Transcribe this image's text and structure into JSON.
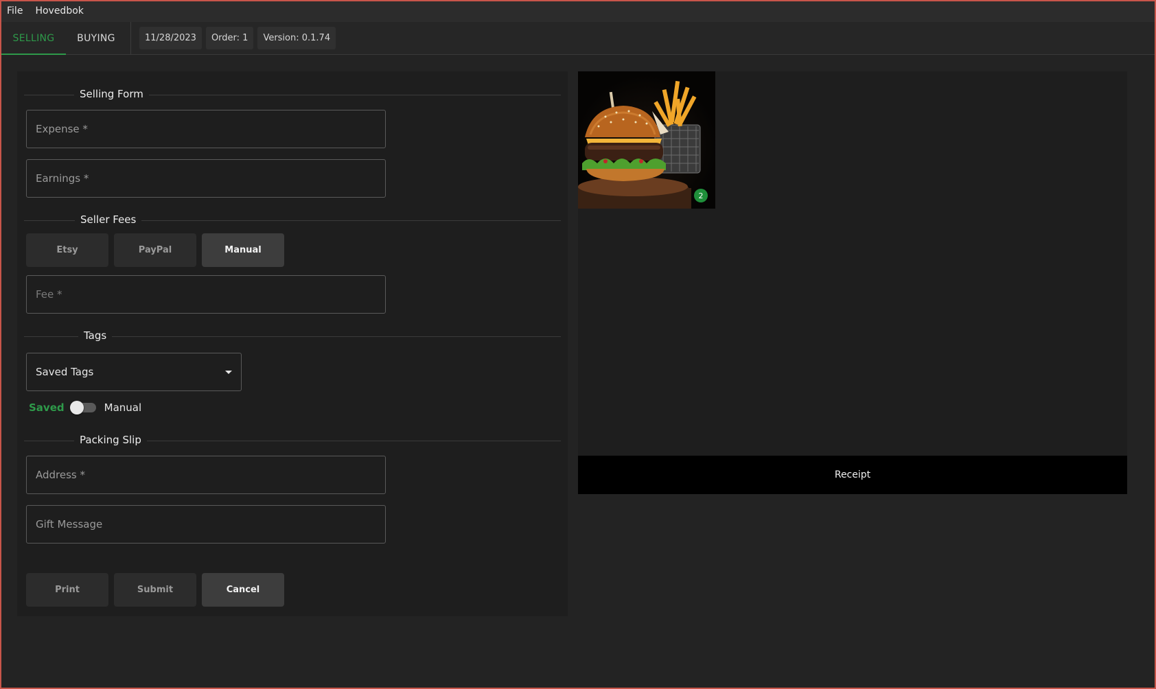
{
  "menubar": {
    "items": [
      "File",
      "Hovedbok"
    ]
  },
  "tabs": [
    {
      "label": "SELLING",
      "active": true
    },
    {
      "label": "BUYING",
      "active": false
    }
  ],
  "status": {
    "date": "11/28/2023",
    "order": "Order: 1",
    "version": "Version: 0.1.74"
  },
  "form": {
    "selling_title": "Selling Form",
    "expense_placeholder": "Expense *",
    "earnings_placeholder": "Earnings *",
    "fees_title": "Seller Fees",
    "fee_options": [
      "Etsy",
      "PayPal",
      "Manual"
    ],
    "fee_selected": "Manual",
    "fee_placeholder": "Fee *",
    "tags_title": "Tags",
    "tags_select_value": "Saved Tags",
    "toggle_left": "Saved",
    "toggle_right": "Manual",
    "packing_title": "Packing Slip",
    "address_placeholder": "Address *",
    "gift_placeholder": "Gift Message",
    "actions": {
      "print": "Print",
      "submit": "Submit",
      "cancel": "Cancel"
    }
  },
  "preview": {
    "image_alt": "burger-and-fries-photo",
    "badge_count": "2",
    "receipt_label": "Receipt"
  },
  "colors": {
    "accent": "#2e9a4a",
    "frame": "#c8554a",
    "badge": "#1f8f3a"
  }
}
